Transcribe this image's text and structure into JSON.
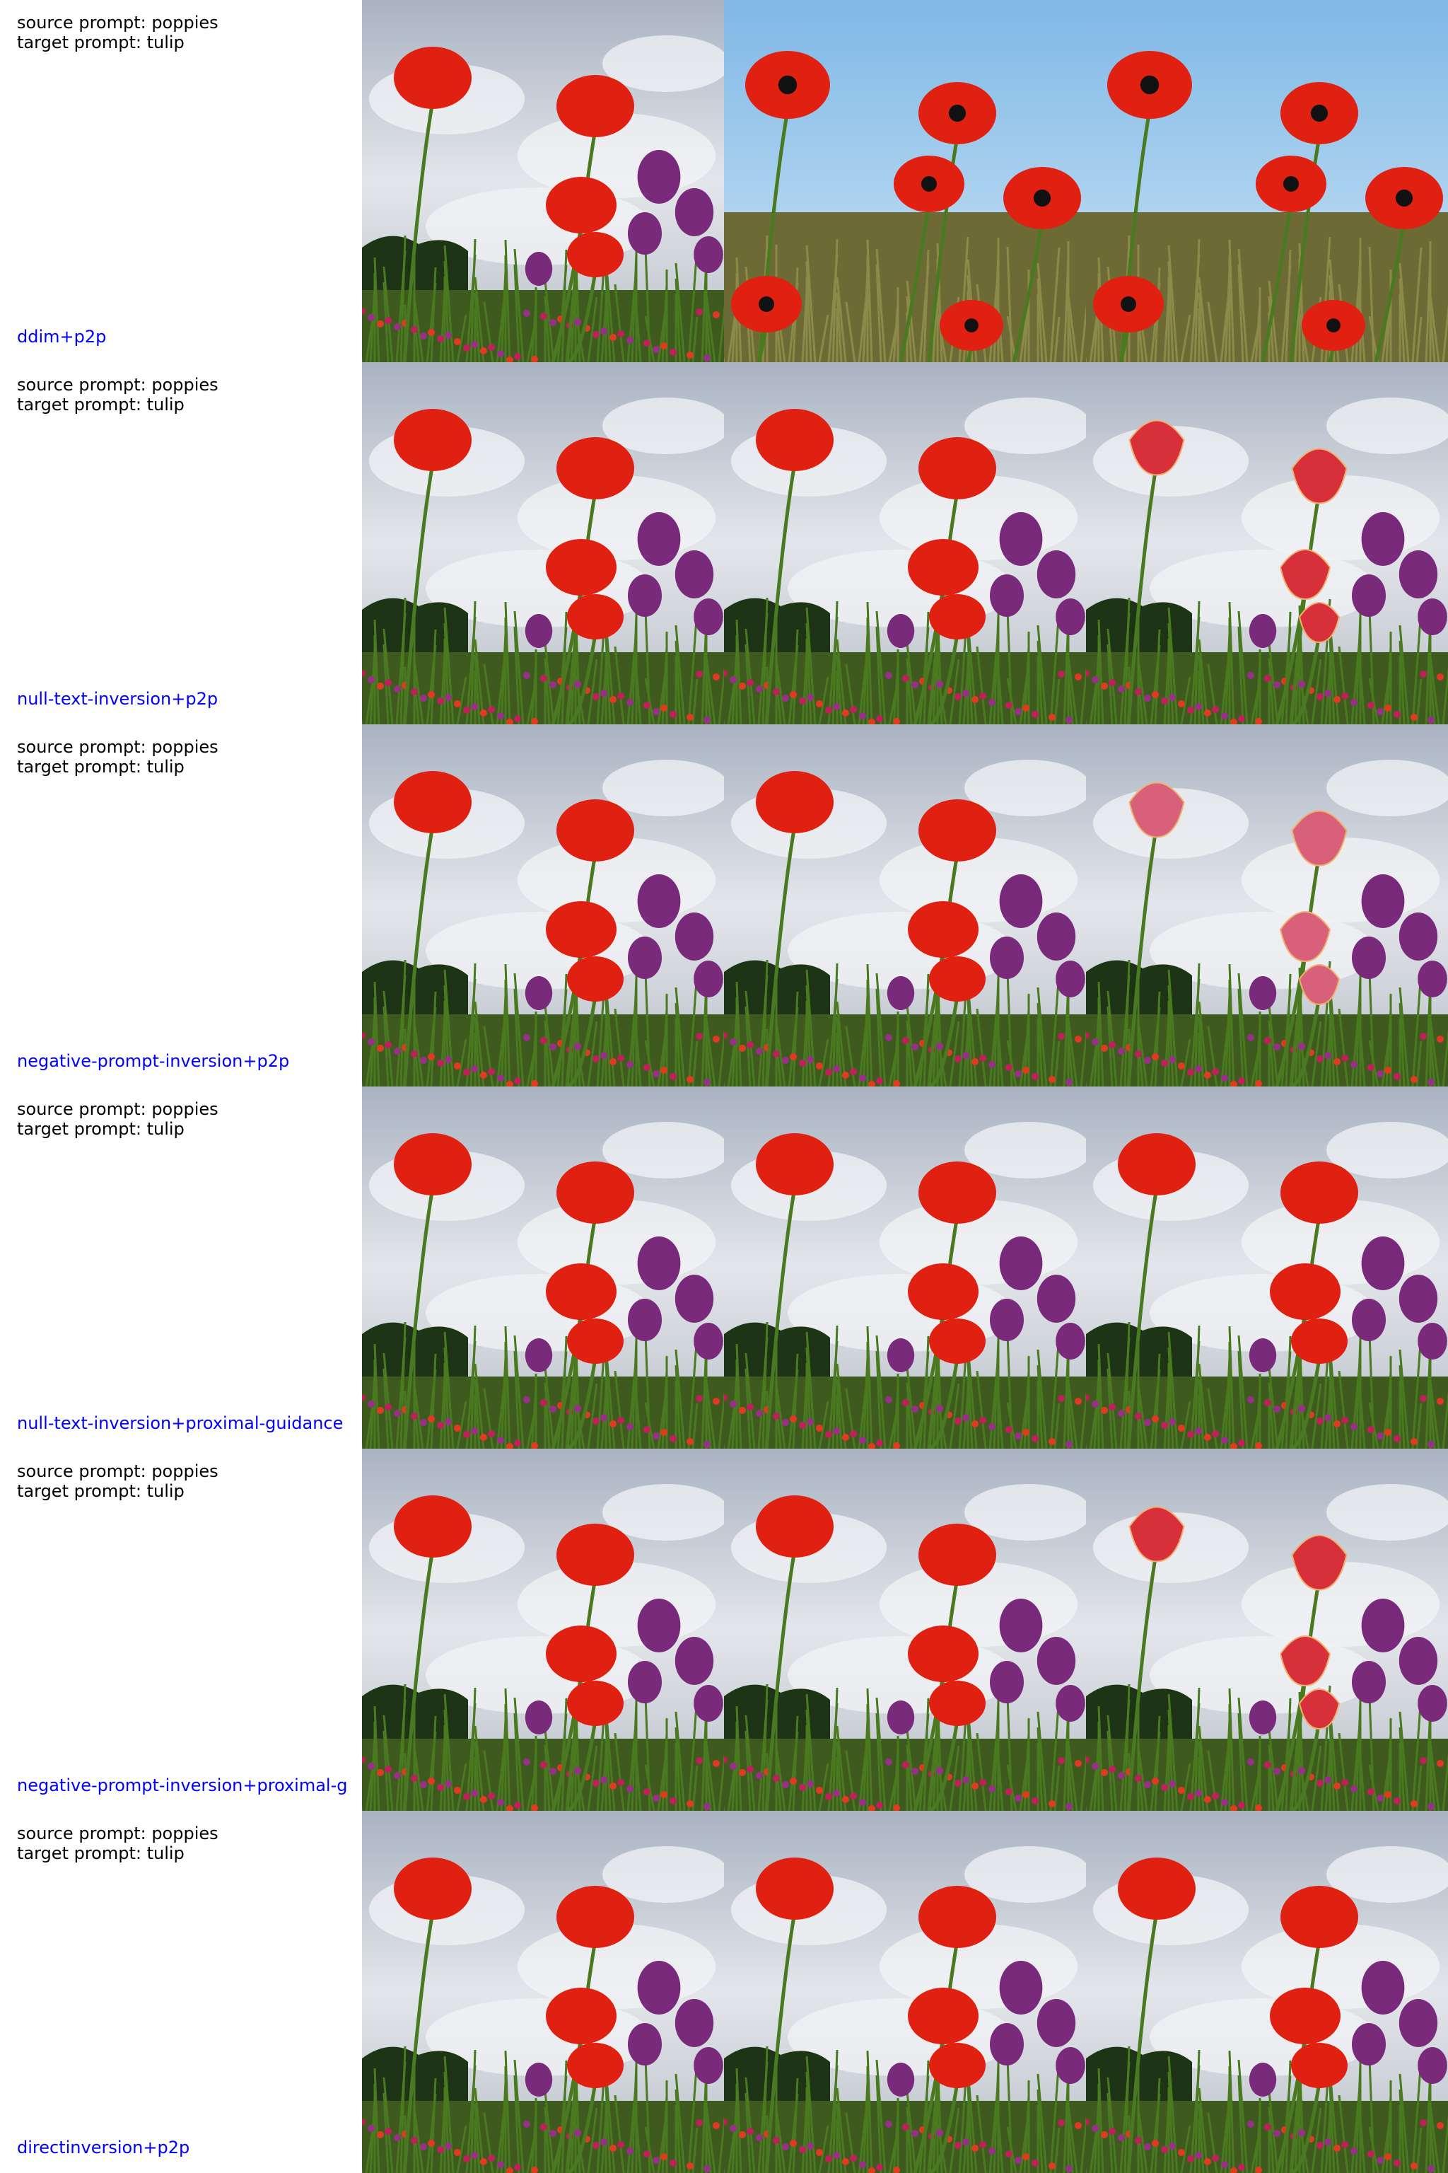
{
  "source_label": "source prompt: poppies",
  "target_label": "target prompt: tulip",
  "rows": [
    {
      "method": "ddim+p2p",
      "cells": [
        "poppy-sky",
        "poppy-blue-sky",
        "poppy-blue-sky"
      ]
    },
    {
      "method": "null-text-inversion+p2p",
      "cells": [
        "poppy-sky",
        "poppy-sky",
        "tulip-sky"
      ]
    },
    {
      "method": "negative-prompt-inversion+p2p",
      "cells": [
        "poppy-sky",
        "poppy-sky",
        "tulip-pink-sky"
      ]
    },
    {
      "method": "null-text-inversion+proximal-guidance",
      "cells": [
        "poppy-sky",
        "poppy-sky",
        "poppy-sky"
      ]
    },
    {
      "method": "negative-prompt-inversion+proximal-g",
      "cells": [
        "poppy-sky",
        "poppy-sky",
        "tulip-sky"
      ]
    },
    {
      "method": "directinversion+p2p",
      "cells": [
        "poppy-sky",
        "poppy-sky",
        "poppy-sky"
      ]
    }
  ],
  "colors": {
    "method_label": "#0000ff",
    "prompt_text": "#000000",
    "poppy_red": "#e02010",
    "tulip_red": "#d8303a",
    "tulip_pink": "#d8607a",
    "purple": "#7a2a7a",
    "stem": "#4a7a20",
    "sky_cloud": "#c8ccd4",
    "sky_blue": "#9cc8e8"
  }
}
